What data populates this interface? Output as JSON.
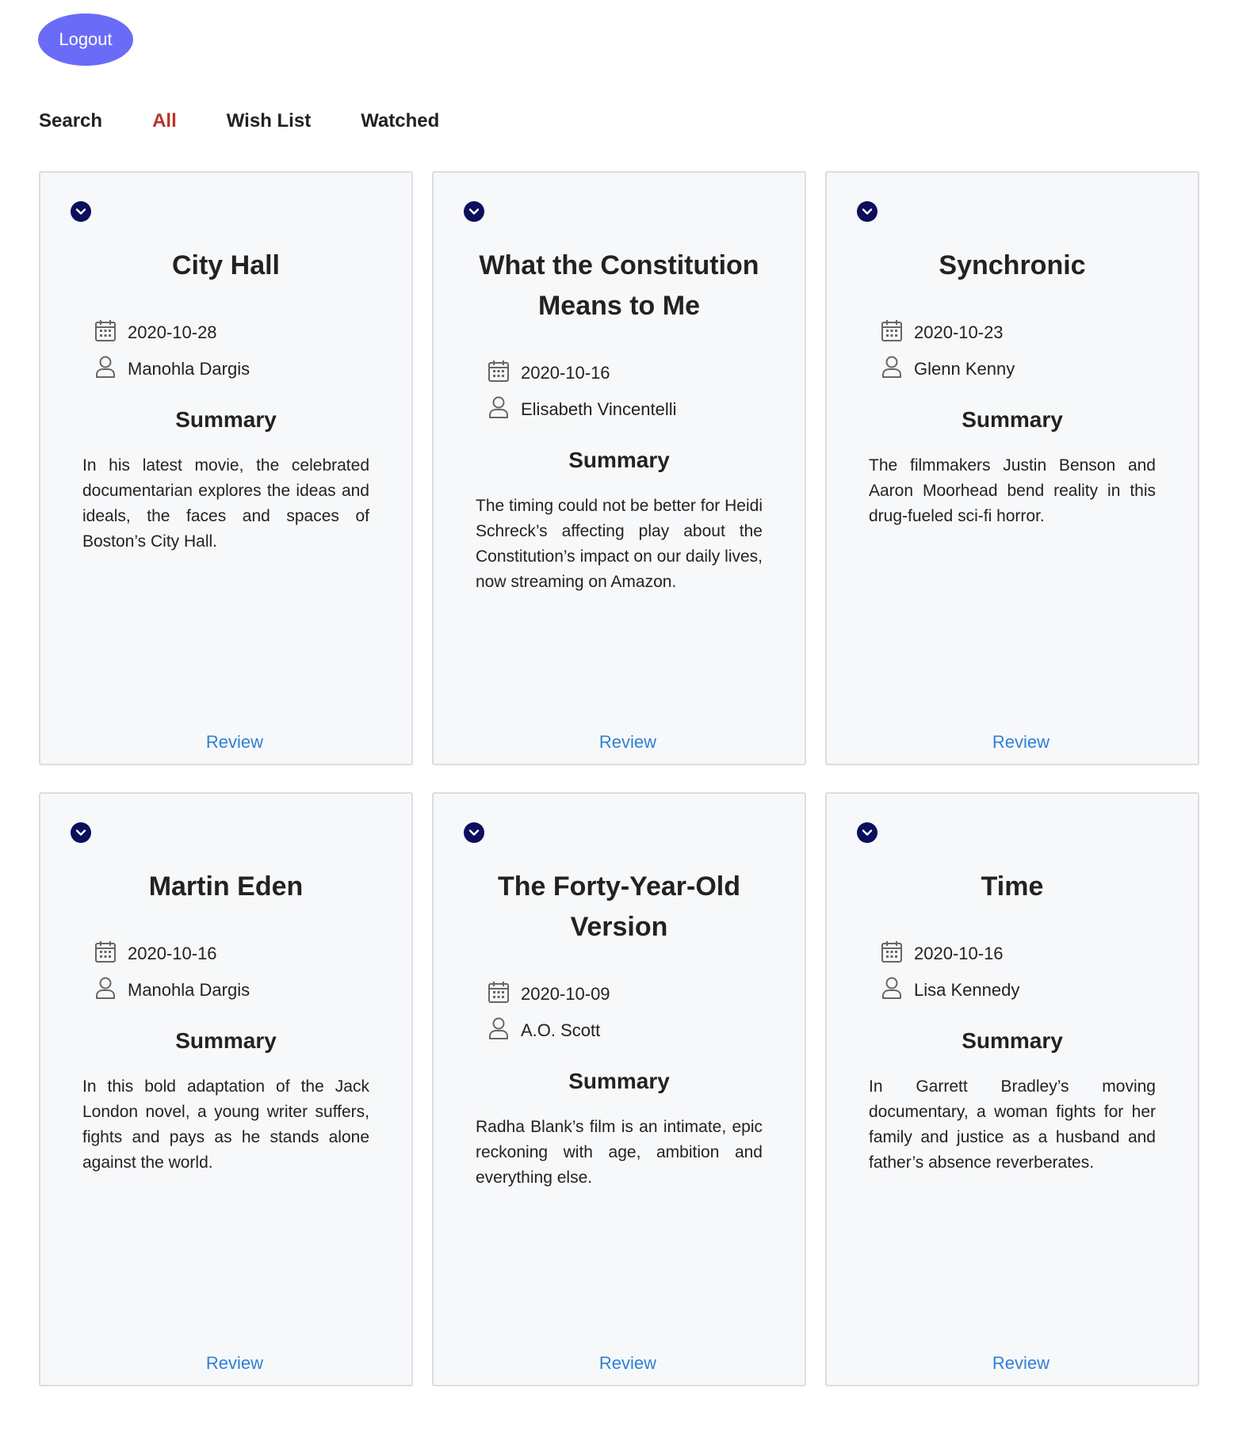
{
  "header": {
    "logout_label": "Logout"
  },
  "nav": {
    "tabs": [
      {
        "label": "Search",
        "active": false
      },
      {
        "label": "All",
        "active": true
      },
      {
        "label": "Wish List",
        "active": false
      },
      {
        "label": "Watched",
        "active": false
      }
    ]
  },
  "colors": {
    "logout_button": "#6a6cf7",
    "active_tab": "#b7332a",
    "toggle_icon": "#0b0f5c",
    "review_link": "#2f80d8",
    "card_background": "#f7f8fa"
  },
  "icons": {
    "toggle": "chevron-down-icon",
    "date": "calendar-icon",
    "author": "user-icon"
  },
  "cards": [
    {
      "title": "City Hall",
      "date": "2020-10-28",
      "author": "Manohla Dargis",
      "summary_heading": "Summary",
      "summary": "In his latest movie, the celebrated documentarian explores the ideas and ideals, the faces and spaces of Boston’s City Hall.",
      "review_label": "Review"
    },
    {
      "title": "What the Constitution Means to Me",
      "date": "2020-10-16",
      "author": "Elisabeth Vincentelli",
      "summary_heading": "Summary",
      "summary": "The timing could not be better for Heidi Schreck’s affecting play about the Constitution’s impact on our daily lives, now streaming on Amazon.",
      "review_label": "Review"
    },
    {
      "title": "Synchronic",
      "date": "2020-10-23",
      "author": "Glenn Kenny",
      "summary_heading": "Summary",
      "summary": "The filmmakers Justin Benson and Aaron Moorhead bend reality in this drug-fueled sci-fi horror.",
      "review_label": "Review"
    },
    {
      "title": "Martin Eden",
      "date": "2020-10-16",
      "author": "Manohla Dargis",
      "summary_heading": "Summary",
      "summary": "In this bold adaptation of the Jack London novel, a young writer suffers, fights and pays as he stands alone against the world.",
      "review_label": "Review"
    },
    {
      "title": "The Forty-Year-Old Version",
      "date": "2020-10-09",
      "author": "A.O. Scott",
      "summary_heading": "Summary",
      "summary": "Radha Blank’s film is an intimate, epic reckoning with age, ambition and everything else.",
      "review_label": "Review"
    },
    {
      "title": "Time",
      "date": "2020-10-16",
      "author": "Lisa Kennedy",
      "summary_heading": "Summary",
      "summary": "In Garrett Bradley’s moving documentary, a woman fights for her family and justice as a husband and father’s absence reverberates.",
      "review_label": "Review"
    }
  ]
}
